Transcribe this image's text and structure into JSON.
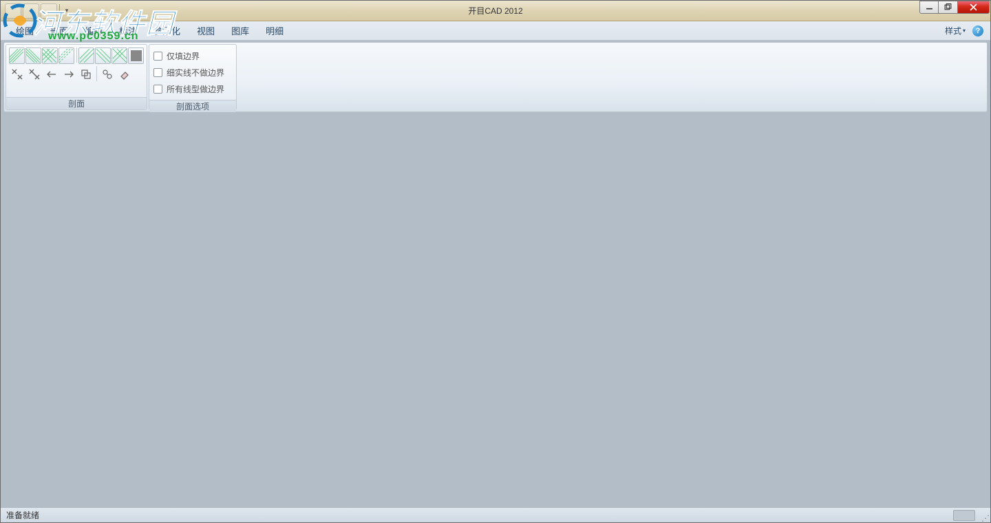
{
  "title": "开目CAD 2012",
  "menus": [
    "绘图",
    "剖面",
    "编辑",
    "标注",
    "参数化",
    "视图",
    "图库",
    "明细"
  ],
  "style_label": "样式",
  "ribbon": {
    "group_section_title": "剖面",
    "group_options_title": "剖面选项",
    "options": [
      "仅填边界",
      "细实线不做边界",
      "所有线型做边界"
    ]
  },
  "status": "准备就绪",
  "watermark": {
    "text": "河东软件园",
    "url": "www.pc0359.cn"
  }
}
